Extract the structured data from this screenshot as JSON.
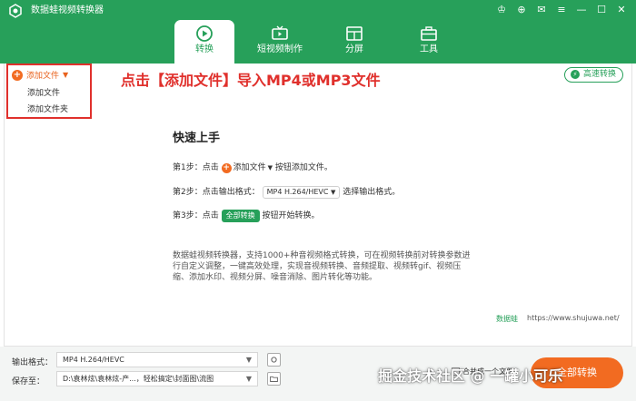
{
  "app": {
    "title": "数据蛙视频转换器",
    "colors": {
      "brand": "#27a05a",
      "accent": "#f26b21",
      "annotation": "#e0302c"
    }
  },
  "window_controls": {
    "icons": [
      "crown-icon",
      "cart-icon",
      "email-icon",
      "menu-icon",
      "minimize-icon",
      "maximize-icon",
      "close-icon"
    ],
    "glyphs": [
      "♔",
      "⊕",
      "✉",
      "≡",
      "—",
      "☐",
      "✕"
    ]
  },
  "tabs": [
    {
      "label": "转换",
      "icon": "convert-icon",
      "active": true
    },
    {
      "label": "短视频制作",
      "icon": "tv-icon",
      "active": false
    },
    {
      "label": "分屏",
      "icon": "split-screen-icon",
      "active": false
    },
    {
      "label": "工具",
      "icon": "toolbox-icon",
      "active": false
    }
  ],
  "add_menu": {
    "button_label": "添加文件",
    "items": [
      "添加文件",
      "添加文件夹"
    ]
  },
  "annotation": "点击【添加文件】导入MP4或MP3文件",
  "speed_button": "高速转换",
  "quick_start": {
    "title": "快速上手",
    "step1": {
      "prefix": "第1步：点击",
      "button": "添加文件",
      "suffix": "按钮添加文件。"
    },
    "step2": {
      "prefix": "第2步：点击输出格式：",
      "format": "MP4 H.264/HEVC",
      "suffix": "选择输出格式。"
    },
    "step3": {
      "prefix": "第3步：点击",
      "button": "全部转换",
      "suffix": "按钮开始转换。"
    }
  },
  "description": "数据蛙视频转换器，支持1000+种音视频格式转换，可在视频转换前对转换参数进行自定义调整，一键高效处理，实现音视频转换、音频提取、视频转gif、视频压缩、添加水印、视频分屏、噪音消除、图片转化等功能。",
  "footer_brand": "数据蛙",
  "footer_site": "https://www.shujuwa.net/",
  "bottom": {
    "output_label": "输出格式：",
    "output_value": "MP4 H.264/HEVC",
    "save_label": "保存至：",
    "save_value": "D:\\袁林炫\\袁林炫-产...，轻松搞定\\封面图\\流图",
    "merge_label": "合并成一个文件",
    "convert_label": "全部转换"
  },
  "watermark": "掘金技术社区 @ 一罐小可乐"
}
